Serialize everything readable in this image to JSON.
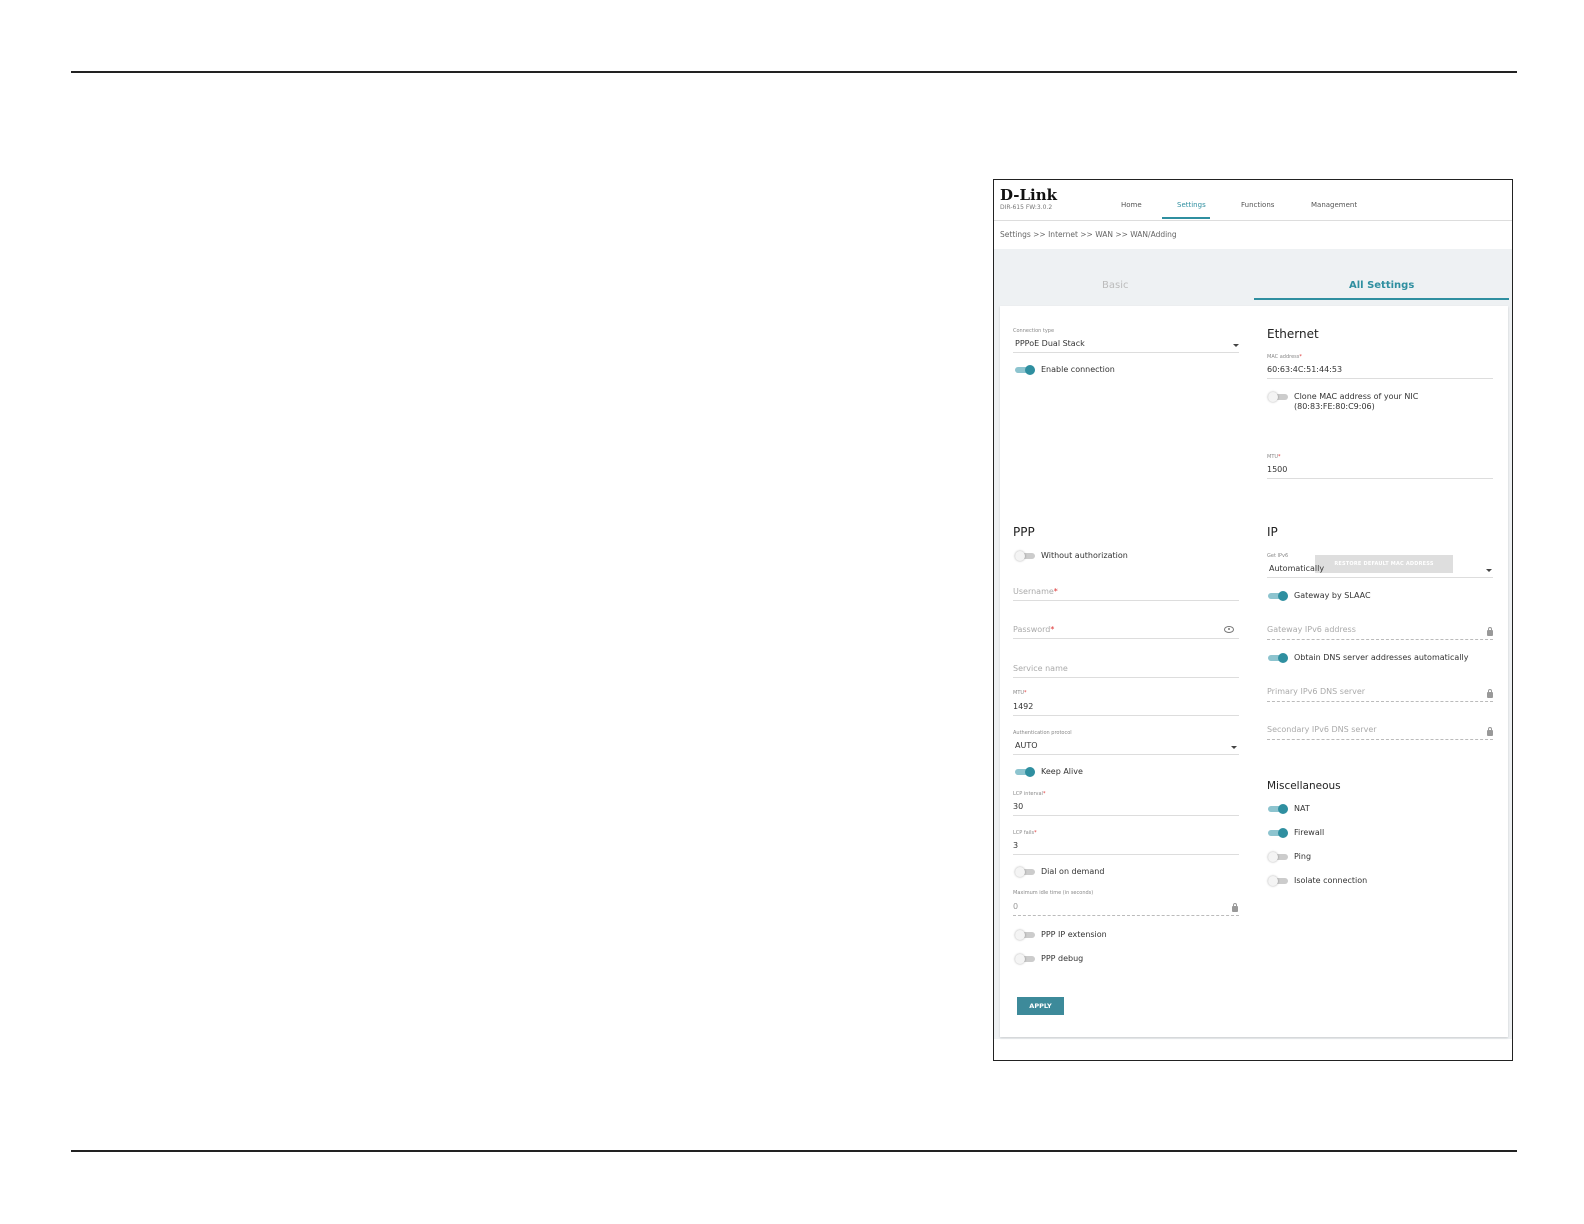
{
  "header": {
    "logo": "D-Link",
    "model": "DIR-615 FW:3.0.2",
    "nav": [
      "Home",
      "Settings",
      "Functions",
      "Management"
    ],
    "active_nav": "Settings"
  },
  "breadcrumb": "Settings >> Internet >> WAN >> WAN/Adding",
  "tabs": {
    "basic": "Basic",
    "all": "All Settings"
  },
  "connection": {
    "type_label": "Connection type",
    "type_value": "PPPoE Dual Stack",
    "enable_label": "Enable connection",
    "enable_on": true
  },
  "ethernet": {
    "title": "Ethernet",
    "mac_label": "MAC address",
    "mac_value": "60:63:4C:51:44:53",
    "clone_label": "Clone MAC address of your NIC",
    "clone_mac": "(80:83:FE:80:C9:06)",
    "clone_on": false,
    "restore_button": "RESTORE DEFAULT MAC ADDRESS",
    "mtu_label": "MTU",
    "mtu_value": "1500"
  },
  "ppp": {
    "title": "PPP",
    "without_auth_label": "Without authorization",
    "without_auth_on": false,
    "username_placeholder": "Username",
    "password_placeholder": "Password",
    "service_placeholder": "Service name",
    "mtu_label": "MTU",
    "mtu_value": "1492",
    "auth_label": "Authentication protocol",
    "auth_value": "AUTO",
    "keepalive_label": "Keep Alive",
    "keepalive_on": true,
    "lcp_interval_label": "LCP interval",
    "lcp_interval_value": "30",
    "lcp_fails_label": "LCP fails",
    "lcp_fails_value": "3",
    "dial_label": "Dial on demand",
    "dial_on": false,
    "idle_label": "Maximum idle time (in seconds)",
    "idle_value": "0",
    "ip_ext_label": "PPP IP extension",
    "ip_ext_on": false,
    "debug_label": "PPP debug",
    "debug_on": false
  },
  "ip": {
    "title": "IP",
    "get_ipv6_label": "Get IPv6",
    "get_ipv6_value": "Automatically",
    "slaac_label": "Gateway by SLAAC",
    "slaac_on": true,
    "gateway_placeholder": "Gateway IPv6 address",
    "dns_auto_label": "Obtain DNS server addresses automatically",
    "dns_auto_on": true,
    "primary_dns_placeholder": "Primary IPv6 DNS server",
    "secondary_dns_placeholder": "Secondary IPv6 DNS server"
  },
  "misc": {
    "title": "Miscellaneous",
    "nat_label": "NAT",
    "nat_on": true,
    "firewall_label": "Firewall",
    "firewall_on": true,
    "ping_label": "Ping",
    "ping_on": false,
    "isolate_label": "Isolate connection",
    "isolate_on": false
  },
  "apply_button": "APPLY"
}
